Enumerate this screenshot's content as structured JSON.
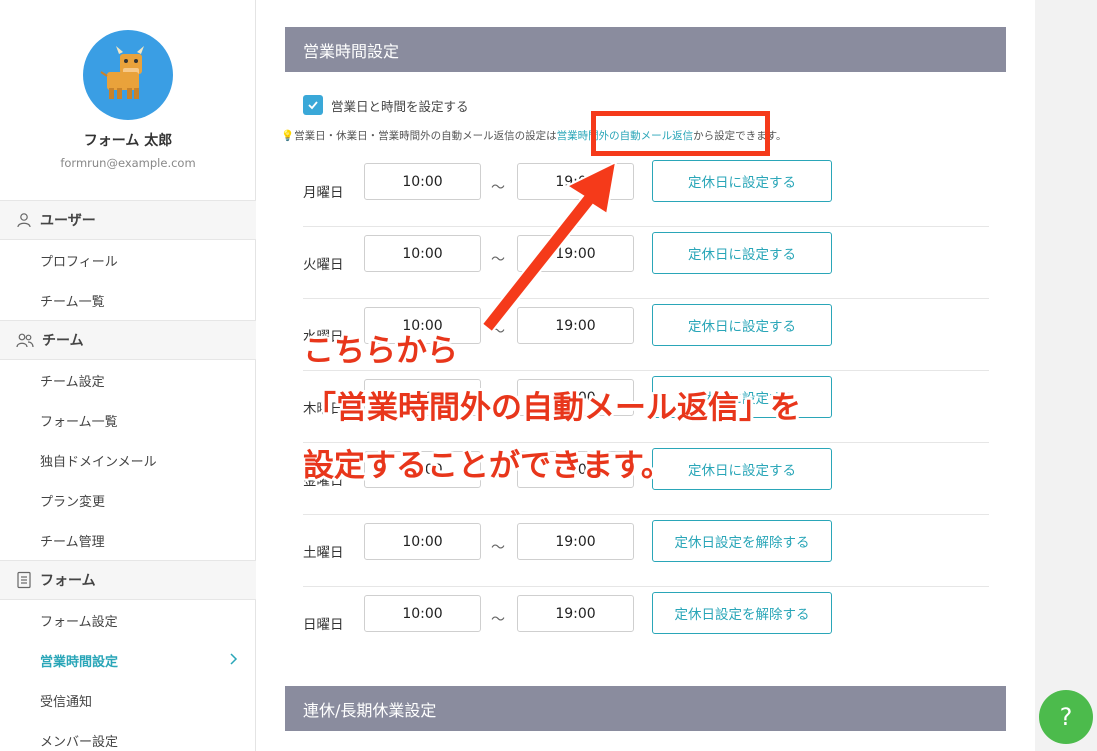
{
  "user": {
    "name": "フォーム 太郎",
    "email": "formrun@example.com"
  },
  "nav": {
    "sections": [
      {
        "label": "ユーザー",
        "icon": "user-icon",
        "items": [
          "プロフィール",
          "チーム一覧"
        ]
      },
      {
        "label": "チーム",
        "icon": "team-icon",
        "items": [
          "チーム設定",
          "フォーム一覧",
          "独自ドメインメール",
          "プラン変更",
          "チーム管理"
        ]
      },
      {
        "label": "フォーム",
        "icon": "document-icon",
        "items": [
          "フォーム設定",
          "営業時間設定",
          "受信通知",
          "メンバー設定"
        ]
      }
    ],
    "active_item": "営業時間設定"
  },
  "business_hours": {
    "header": "営業時間設定",
    "checkbox_label": "営業日と時間を設定する",
    "checkbox_checked": true,
    "hint_prefix": "💡営業日・休業日・営業時間外の自動メール返信の設定は",
    "hint_link": "営業時間外の自動メール返信",
    "hint_suffix": "から設定できます。",
    "days": [
      {
        "day": "月曜日",
        "start": "10:00",
        "end": "19:00",
        "button": "定休日に設定する"
      },
      {
        "day": "火曜日",
        "start": "10:00",
        "end": "19:00",
        "button": "定休日に設定する"
      },
      {
        "day": "水曜日",
        "start": "10:00",
        "end": "19:00",
        "button": "定休日に設定する"
      },
      {
        "day": "木曜日",
        "start": "10:00",
        "end": "19:00",
        "button": "定休日に設定する"
      },
      {
        "day": "金曜日",
        "start": "10:00",
        "end": "19:00",
        "button": "定休日に設定する"
      },
      {
        "day": "土曜日",
        "start": "10:00",
        "end": "19:00",
        "button": "定休日設定を解除する"
      },
      {
        "day": "日曜日",
        "start": "10:00",
        "end": "19:00",
        "button": "定休日設定を解除する"
      }
    ],
    "separator": "〜"
  },
  "holiday_section": {
    "header": "連休/長期休業設定"
  },
  "annotation": {
    "line1": "こちらから",
    "line2": "「営業時間外の自動メール返信」を",
    "line3": "設定することができます。",
    "color": "#f53a1a"
  },
  "help_button": {
    "label": "?"
  },
  "colors": {
    "accent": "#2aa6b8",
    "header_bg": "#8a8c9e",
    "checkbox": "#3aa8d8",
    "help": "#4cbb4c"
  }
}
